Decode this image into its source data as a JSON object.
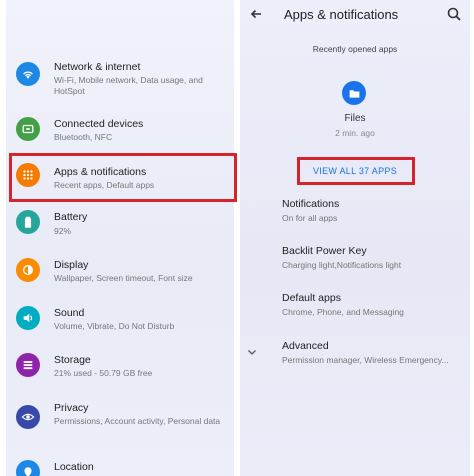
{
  "left_panel": {
    "items": [
      {
        "title": "Network & internet",
        "subtitle": "Wi-Fi, Mobile network, Data usage, and HotSpot",
        "icon": "wifi-icon",
        "color": "#1e88e5"
      },
      {
        "title": "Connected devices",
        "subtitle": "Bluetooth, NFC",
        "icon": "connected-devices-icon",
        "color": "#43a047"
      },
      {
        "title": "Apps & notifications",
        "subtitle": "Recent apps, Default apps",
        "icon": "apps-grid-icon",
        "color": "#f57c00"
      },
      {
        "title": "Battery",
        "subtitle": "92%",
        "icon": "battery-icon",
        "color": "#26a69a"
      },
      {
        "title": "Display",
        "subtitle": "Wallpaper, Screen timeout, Font size",
        "icon": "display-icon",
        "color": "#fb8c00"
      },
      {
        "title": "Sound",
        "subtitle": "Volume, Vibrate, Do Not Disturb",
        "icon": "sound-icon",
        "color": "#00acc1"
      },
      {
        "title": "Storage",
        "subtitle": "21% used - 50.79 GB free",
        "icon": "storage-icon",
        "color": "#8e24aa"
      },
      {
        "title": "Privacy",
        "subtitle": "Permissions, Account activity, Personal data",
        "icon": "privacy-icon",
        "color": "#3949ab"
      },
      {
        "title": "Location",
        "subtitle": "",
        "icon": "location-icon",
        "color": "#1e88e5"
      }
    ]
  },
  "right_panel": {
    "title": "Apps & notifications",
    "recent_label": "Recently opened apps",
    "recent_app": {
      "name": "Files",
      "time": "2 min. ago",
      "icon": "folder-icon",
      "color": "#1a73e8"
    },
    "view_all": "VIEW ALL 37 APPS",
    "items": [
      {
        "title": "Notifications",
        "subtitle": "On for all apps"
      },
      {
        "title": "Backlit Power Key",
        "subtitle": "Charging light,Notifications light"
      },
      {
        "title": "Default apps",
        "subtitle": "Chrome, Phone, and Messaging"
      },
      {
        "title": "Advanced",
        "subtitle": "Permission manager, Wireless Emergency..."
      }
    ]
  },
  "colors": {
    "highlight": "#d6232c",
    "accent": "#1a73e8"
  }
}
